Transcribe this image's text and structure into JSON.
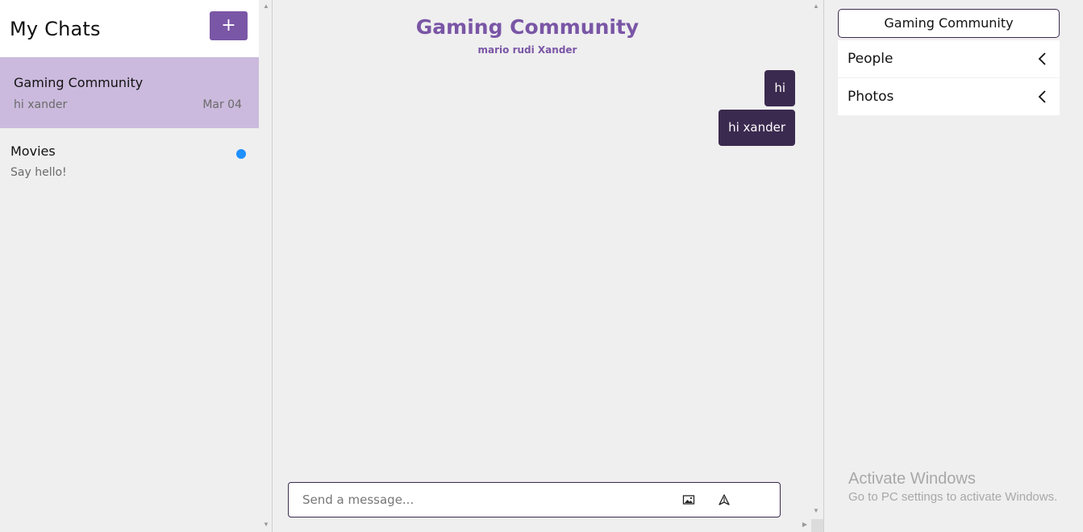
{
  "sidebar": {
    "title": "My Chats",
    "new_chat_label": "+",
    "chats": [
      {
        "name": "Gaming Community",
        "preview": "hi xander",
        "date": "Mar 04",
        "active": true
      },
      {
        "name": "Movies",
        "preview": "Say hello!",
        "unread": true
      }
    ],
    "unread_color": "#1e90ff"
  },
  "chat": {
    "title": "Gaming Community",
    "members": "mario rudi Xander",
    "messages": [
      {
        "text": "hi",
        "own": true
      },
      {
        "text": "hi xander",
        "own": true
      }
    ],
    "composer": {
      "placeholder": "Send a message...",
      "value": "",
      "attach_icon": "image-icon",
      "send_icon": "send-icon"
    }
  },
  "details": {
    "title": "Gaming Community",
    "sections": [
      {
        "label": "People",
        "icon": "chevron-left-icon"
      },
      {
        "label": "Photos",
        "icon": "chevron-left-icon"
      }
    ]
  },
  "watermark": {
    "title": "Activate Windows",
    "subtitle": "Go to PC settings to activate Windows."
  },
  "colors": {
    "accent": "#7a56a6",
    "active_chat_bg": "#cbbadd",
    "bubble_bg": "#3b2a4f",
    "background": "#efefef"
  }
}
